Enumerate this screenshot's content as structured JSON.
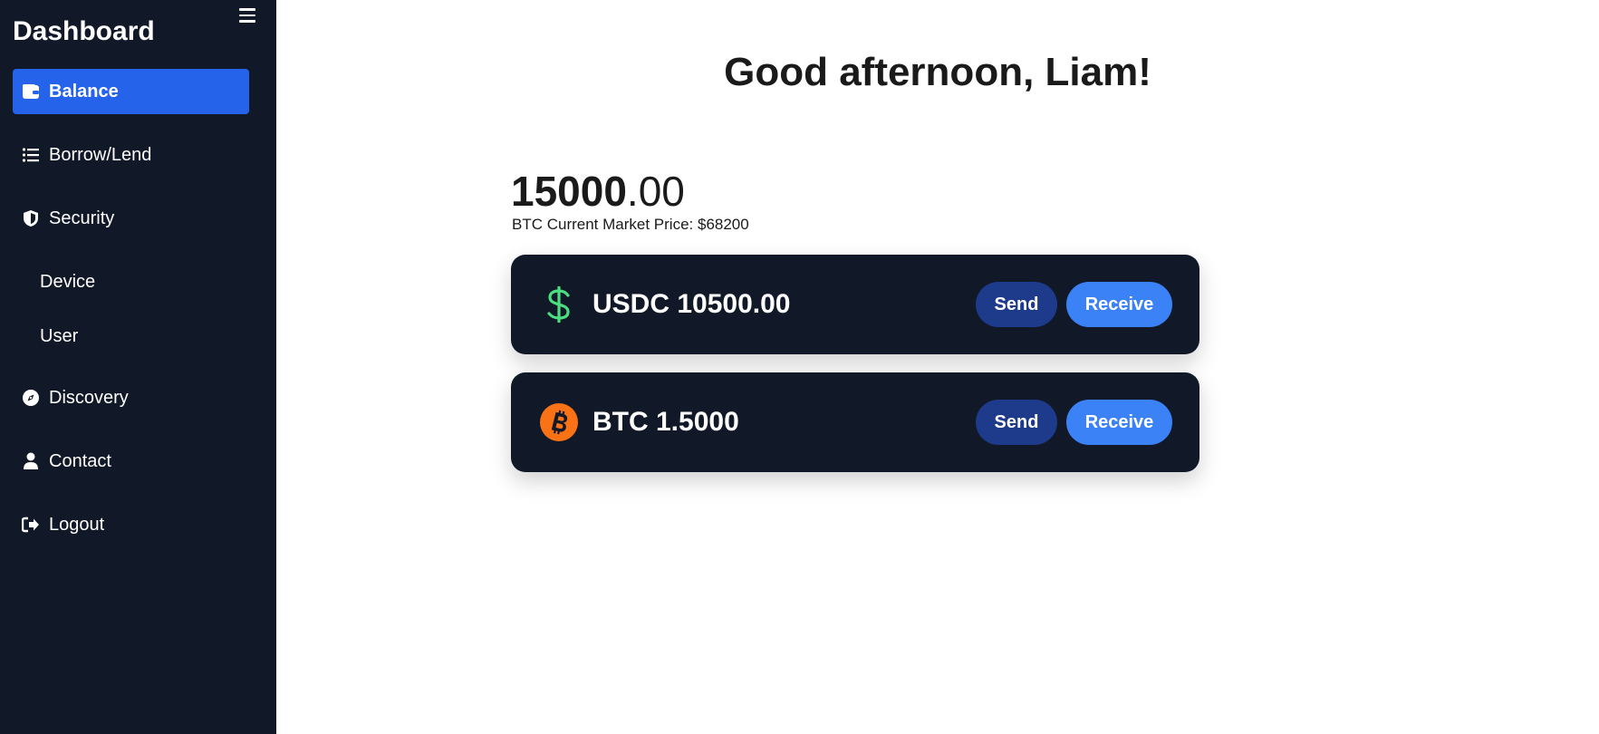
{
  "sidebar": {
    "title": "Dashboard",
    "items": [
      {
        "label": "Balance",
        "icon": "wallet-icon",
        "active": true
      },
      {
        "label": "Borrow/Lend",
        "icon": "list-icon"
      },
      {
        "label": "Security",
        "icon": "shield-icon"
      },
      {
        "label": "Discovery",
        "icon": "compass-icon"
      },
      {
        "label": "Contact",
        "icon": "user-icon"
      },
      {
        "label": "Logout",
        "icon": "logout-icon"
      }
    ],
    "security_subitems": [
      "Device",
      "User"
    ]
  },
  "main": {
    "greeting": "Good afternoon, Liam!",
    "balance_int": "15000",
    "balance_dec": ".00",
    "price_note": "BTC Current Market Price: $68200",
    "assets": [
      {
        "label": "USDC 10500.00",
        "icon": "dollar-icon",
        "send": "Send",
        "receive": "Receive"
      },
      {
        "label": "BTC 1.5000",
        "icon": "bitcoin-icon",
        "send": "Send",
        "receive": "Receive"
      }
    ]
  },
  "colors": {
    "sidebar_bg": "#111827",
    "active_item": "#2563eb",
    "send_button": "#1e3a8a",
    "receive_button": "#3b82f6",
    "dollar_green": "#4ade80",
    "bitcoin_orange": "#f97316"
  }
}
